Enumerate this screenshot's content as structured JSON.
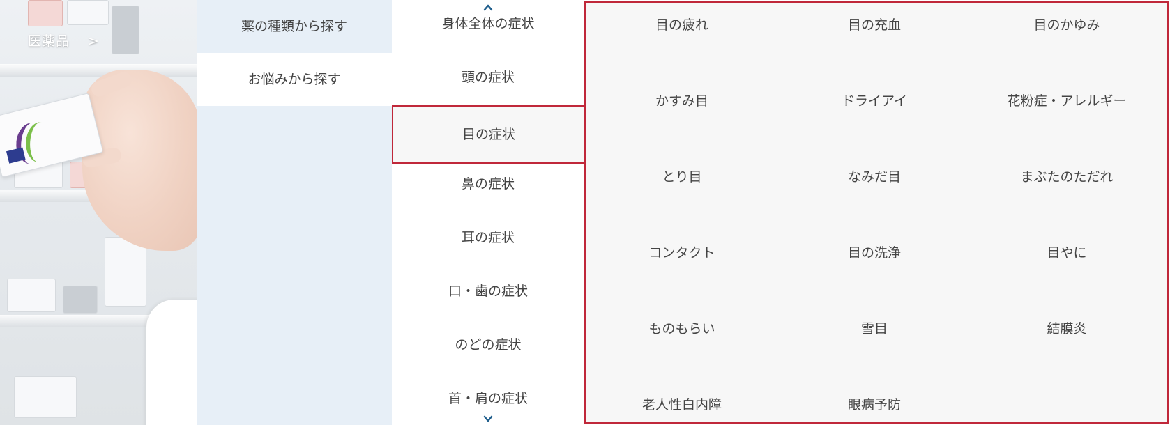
{
  "hero": {
    "link_label": "医薬品",
    "arrow": ">"
  },
  "search_modes": [
    {
      "label": "薬の種類から探す"
    },
    {
      "label": "お悩みから探す"
    }
  ],
  "body_areas": {
    "items": [
      "身体全体の症状",
      "頭の症状",
      "目の症状",
      "鼻の症状",
      "耳の症状",
      "口・歯の症状",
      "のどの症状",
      "首・肩の症状"
    ],
    "selected": "目の症状"
  },
  "symptoms": [
    "目の疲れ",
    "目の充血",
    "目のかゆみ",
    "かすみ目",
    "ドライアイ",
    "花粉症・アレルギー",
    "とり目",
    "なみだ目",
    "まぶたのただれ",
    "コンタクト",
    "目の洗浄",
    "目やに",
    "ものもらい",
    "雪目",
    "結膜炎",
    "老人性白内障",
    "眼病予防"
  ],
  "colors": {
    "accent": "#c0283a",
    "mode_bg": "#e7eff7",
    "panel_bg": "#f7f7f7",
    "chevron": "#1f5e8c"
  },
  "icons": {
    "scroll_up": "chevron-up-icon",
    "scroll_down": "chevron-down-icon"
  }
}
